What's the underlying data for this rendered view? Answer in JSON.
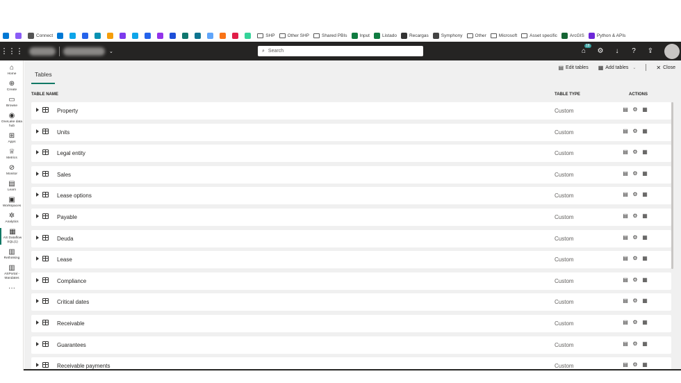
{
  "bookmarks": [
    {
      "label": "",
      "color": "#0078d4"
    },
    {
      "label": "",
      "color": "#8a5cf6"
    },
    {
      "label": "Connect",
      "color": "#555555"
    },
    {
      "label": "",
      "color": "#0078d4"
    },
    {
      "label": "",
      "color": "#0ea5e9"
    },
    {
      "label": "",
      "color": "#2563eb"
    },
    {
      "label": "",
      "color": "#0891b2"
    },
    {
      "label": "",
      "color": "#f59e0b"
    },
    {
      "label": "",
      "color": "#7c3aed"
    },
    {
      "label": "",
      "color": "#0ea5e9"
    },
    {
      "label": "",
      "color": "#2563eb"
    },
    {
      "label": "",
      "color": "#9333ea"
    },
    {
      "label": "",
      "color": "#1d4ed8"
    },
    {
      "label": "",
      "color": "#0f766e"
    },
    {
      "label": "",
      "color": "#0e7490"
    },
    {
      "label": "",
      "color": "#60a5fa"
    },
    {
      "label": "",
      "color": "#f97316"
    },
    {
      "label": "",
      "color": "#e11d48"
    },
    {
      "label": "",
      "color": "#34d399"
    },
    {
      "label": "SHP",
      "folder": true
    },
    {
      "label": "Other SHP",
      "folder": true
    },
    {
      "label": "Shared PBIs",
      "folder": true
    },
    {
      "label": "Input",
      "color": "#107c41"
    },
    {
      "label": "Listado",
      "color": "#107c41"
    },
    {
      "label": "Recargas",
      "color": "#333333"
    },
    {
      "label": "Symphony",
      "color": "#444444"
    },
    {
      "label": "Other",
      "folder": true
    },
    {
      "label": "Microsoft",
      "folder": true
    },
    {
      "label": "Asset specific",
      "folder": true
    },
    {
      "label": "ArcGIS",
      "color": "#166534"
    },
    {
      "label": "Python & APIs",
      "color": "#6d28d9"
    }
  ],
  "appbar": {
    "search_placeholder": "Search",
    "notification_count": "18"
  },
  "nav": [
    {
      "label": "Home",
      "icon": "⌂"
    },
    {
      "label": "Create",
      "icon": "⊕"
    },
    {
      "label": "Browse",
      "icon": "▭"
    },
    {
      "label": "OneLake data hub",
      "icon": "◉"
    },
    {
      "label": "Apps",
      "icon": "⊞"
    },
    {
      "label": "Metrics",
      "icon": "♕"
    },
    {
      "label": "Monitor",
      "icon": "⊘"
    },
    {
      "label": "Learn",
      "icon": "▤"
    },
    {
      "label": "Workspaces",
      "icon": "▣"
    },
    {
      "label": "Analytics",
      "icon": "✲"
    },
    {
      "label": "AS Dataflow SQL(1)",
      "icon": "▦"
    },
    {
      "label": "Rethinking",
      "icon": "▥"
    },
    {
      "label": "ASPortal - Mandates",
      "icon": "▥"
    },
    {
      "label": "",
      "icon": "···"
    }
  ],
  "page": {
    "tab": "Tables",
    "edit_tables": "Edit tables",
    "add_tables": "Add tables",
    "close": "Close"
  },
  "table": {
    "headers": {
      "name": "TABLE NAME",
      "type": "TABLE TYPE",
      "actions": "ACTIONS"
    },
    "rows": [
      {
        "name": "Property",
        "type": "Custom"
      },
      {
        "name": "Units",
        "type": "Custom"
      },
      {
        "name": "Legal entity",
        "type": "Custom"
      },
      {
        "name": "Sales",
        "type": "Custom"
      },
      {
        "name": "Lease options",
        "type": "Custom"
      },
      {
        "name": "Payable",
        "type": "Custom"
      },
      {
        "name": "Deuda",
        "type": "Custom"
      },
      {
        "name": "Lease",
        "type": "Custom"
      },
      {
        "name": "Compliance",
        "type": "Custom"
      },
      {
        "name": "Critical dates",
        "type": "Custom"
      },
      {
        "name": "Receivable",
        "type": "Custom"
      },
      {
        "name": "Guarantees",
        "type": "Custom"
      },
      {
        "name": "Receivable payments",
        "type": "Custom"
      }
    ]
  },
  "colors": {
    "appbar": "#252423",
    "accent": "#117865",
    "main_bg": "#f0f0f0"
  }
}
